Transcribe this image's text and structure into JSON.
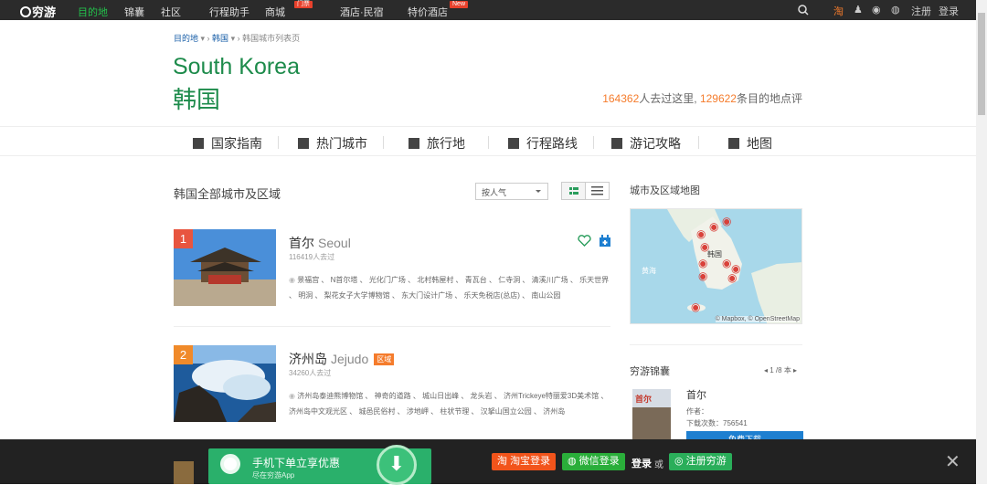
{
  "topbar": {
    "logo": "穷游",
    "nav": [
      "目的地",
      "锦囊",
      "社区",
      "行程助手",
      "商城",
      "酒店·民宿",
      "特价酒店"
    ],
    "badge1": "门票",
    "badge2": "New",
    "register": "注册",
    "login": "登录"
  },
  "breadcrumb": {
    "item1": "目的地",
    "item2": "韩国",
    "current": "韩国城市列表页"
  },
  "country": {
    "en": "South Korea",
    "cn": "韩国",
    "visited": "164362",
    "visited_suffix": "人去过这里,",
    "reviews": "129622",
    "reviews_suffix": "条目的地点评"
  },
  "tabs": [
    "国家指南",
    "热门城市",
    "旅行地",
    "行程路线",
    "游记攻略",
    "地图"
  ],
  "list": {
    "heading": "韩国全部城市及区域",
    "sort": "按人气"
  },
  "items": [
    {
      "rank": "1",
      "name": "首尔",
      "en": "Seoul",
      "tag": "",
      "visits": "116419人去过",
      "sights": "景福宫 、 N首尔塔 、 光化门广场 、 北村韩屋村 、 青瓦台 、 仁寺洞 、 清溪川广场 、 乐天世界 、 明洞 、 梨花女子大学博物馆 、 东大门设计广场 、 乐天免税店(总店) 、 南山公园"
    },
    {
      "rank": "2",
      "name": "济州岛",
      "en": "Jejudo",
      "tag": "区域",
      "visits": "34260人去过",
      "sights": "济州岛泰迪熊博物馆 、 神奇的道路 、 城山日出峰 、 龙头岩 、 济州Trickeye特丽爱3D美术馆 、 济州岛中文观光区 、 城邑民俗村 、 涉地岬 、 柱状节理 、 汉拏山国立公园 、 济州岛"
    }
  ],
  "map": {
    "title": "城市及区域地图",
    "label_korea": "韩国",
    "label_sea": "黄海",
    "attribution": "© Mapbox, © OpenStreetMap"
  },
  "guide": {
    "title": "穷游锦囊",
    "pager": "1 /8 本",
    "name": "首尔",
    "author": "作者：",
    "downloads": "下载次数：756541",
    "download_btn": "免费下载"
  },
  "bottom": {
    "promo_title": "手机下单立享优惠",
    "promo_sub": "尽在穷游App",
    "taobao": "淘宝登录",
    "wechat": "微信登录",
    "login": "登录",
    "or": "或",
    "register": "注册穷游"
  }
}
